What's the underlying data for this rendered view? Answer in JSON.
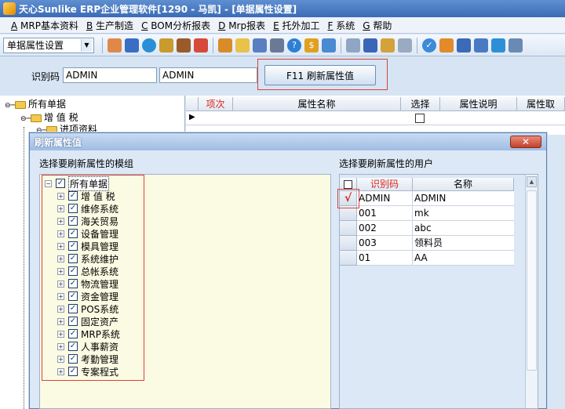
{
  "window": {
    "title": "天心Sunlike ERP企业管理软件[1290 - 马凯] - [单据属性设置]"
  },
  "menu": [
    {
      "key": "A",
      "label": "MRP基本资料"
    },
    {
      "key": "B",
      "label": "生产制造"
    },
    {
      "key": "C",
      "label": "BOM分析报表"
    },
    {
      "key": "D",
      "label": "Mrp报表"
    },
    {
      "key": "E",
      "label": "托外加工"
    },
    {
      "key": "F",
      "label": "系统"
    },
    {
      "key": "G",
      "label": "帮助"
    }
  ],
  "toolbar": {
    "combo_value": "单据属性设置"
  },
  "form": {
    "code_label": "识别码",
    "code_value": "ADMIN",
    "name_value": "ADMIN",
    "refresh_button": "F11 刷新属性值"
  },
  "bg_tree": {
    "root": "所有单据",
    "child1": "增 值 税",
    "child2": "进项资料"
  },
  "bg_grid": {
    "headers": [
      "项次",
      "属性名称",
      "选择",
      "属性说明",
      "属性取"
    ]
  },
  "dialog": {
    "title": "刷新属性值",
    "left_label": "选择要刷新属性的模组",
    "right_label": "选择要刷新属性的用户",
    "tree_root": "所有单据",
    "modules": [
      "增 值 税",
      "维修系统",
      "海关贸易",
      "设备管理",
      "模具管理",
      "系统维护",
      "总帐系统",
      "物流管理",
      "资金管理",
      "POS系统",
      "固定资产",
      "MRP系统",
      "人事薪资",
      "考勤管理",
      "专案程式"
    ],
    "user_headers": [
      "识别码",
      "名称"
    ],
    "users": [
      {
        "code": "ADMIN",
        "name": "ADMIN",
        "checked": true
      },
      {
        "code": "001",
        "name": "mk",
        "checked": false
      },
      {
        "code": "002",
        "name": "abc",
        "checked": false
      },
      {
        "code": "003",
        "name": "领料员",
        "checked": false
      },
      {
        "code": "01",
        "name": "AA",
        "checked": false
      }
    ],
    "check_mark": "√"
  },
  "colors": {
    "highlight": "#d9433a",
    "tree_bg": "#fbfbe3",
    "header_red": "#d9261c"
  }
}
